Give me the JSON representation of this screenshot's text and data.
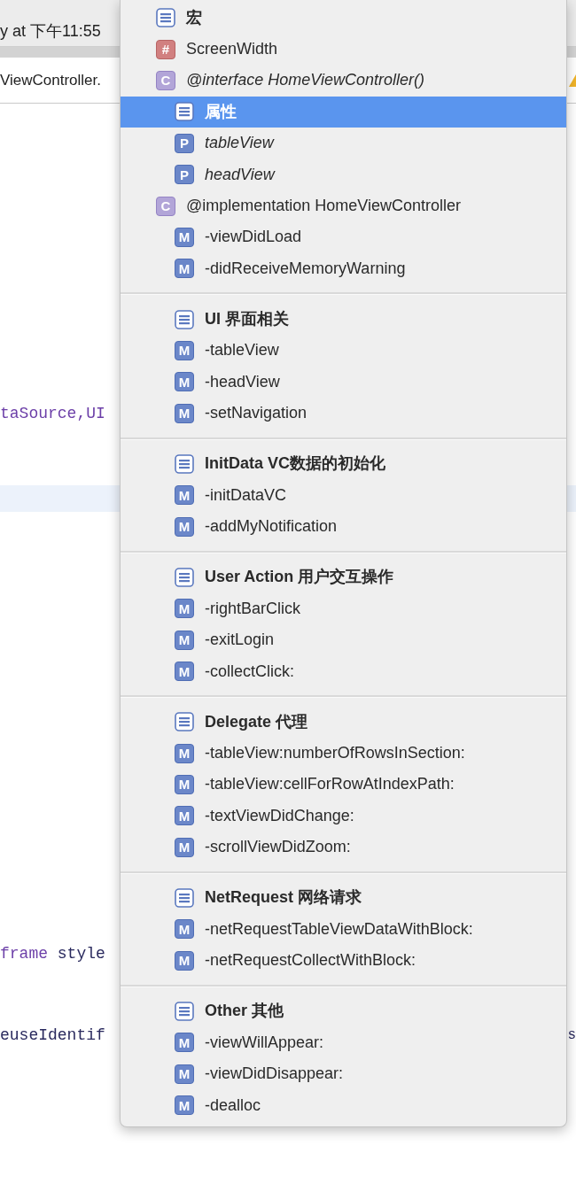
{
  "toolbar": {
    "status": "y at 下午11:55"
  },
  "jump_bar": {
    "path": "ViewController.",
    "warning": true
  },
  "code": {
    "lines": [
      {
        "tokens": [
          {
            "text": "taSource,UI",
            "kind": "type"
          }
        ]
      },
      {
        "current": true
      },
      {
        "tokens": [
          {
            "text": "frame",
            "kind": "type"
          },
          {
            "text": " style",
            "kind": "plain"
          }
        ]
      },
      {
        "tokens": [
          {
            "text": "euseIdentif",
            "kind": "plain"
          }
        ],
        "tail": "s"
      }
    ]
  },
  "menu": {
    "items": [
      {
        "kind": "pragma",
        "label": "宏",
        "selected": false
      },
      {
        "kind": "macro",
        "badge": "#",
        "label": "ScreenWidth",
        "selected": false
      },
      {
        "kind": "class_extension",
        "badge": "C",
        "label": "@interface HomeViewController()",
        "selected": false,
        "children": [
          {
            "kind": "pragma",
            "label": "属性",
            "selected": true
          },
          {
            "kind": "property",
            "badge": "P",
            "label": "tableView",
            "selected": false
          },
          {
            "kind": "property",
            "badge": "P",
            "label": "headView",
            "selected": false
          }
        ]
      },
      {
        "kind": "class",
        "badge": "C",
        "label": "@implementation HomeViewController",
        "selected": false,
        "children": [
          {
            "kind": "method",
            "badge": "M",
            "label": "-viewDidLoad",
            "selected": false
          },
          {
            "kind": "method",
            "badge": "M",
            "label": "-didReceiveMemoryWarning",
            "selected": false
          },
          {
            "kind": "divider"
          },
          {
            "kind": "pragma",
            "label": "UI 界面相关",
            "selected": false
          },
          {
            "kind": "method",
            "badge": "M",
            "label": "-tableView",
            "selected": false
          },
          {
            "kind": "method",
            "badge": "M",
            "label": "-headView",
            "selected": false
          },
          {
            "kind": "method",
            "badge": "M",
            "label": "-setNavigation",
            "selected": false
          },
          {
            "kind": "divider"
          },
          {
            "kind": "pragma",
            "label": "InitData VC数据的初始化",
            "selected": false
          },
          {
            "kind": "method",
            "badge": "M",
            "label": "-initDataVC",
            "selected": false
          },
          {
            "kind": "method",
            "badge": "M",
            "label": "-addMyNotification",
            "selected": false
          },
          {
            "kind": "divider"
          },
          {
            "kind": "pragma",
            "label": "User Action 用户交互操作",
            "selected": false
          },
          {
            "kind": "method",
            "badge": "M",
            "label": "-rightBarClick",
            "selected": false
          },
          {
            "kind": "method",
            "badge": "M",
            "label": "-exitLogin",
            "selected": false
          },
          {
            "kind": "method",
            "badge": "M",
            "label": "-collectClick:",
            "selected": false
          },
          {
            "kind": "divider"
          },
          {
            "kind": "pragma",
            "label": "Delegate 代理",
            "selected": false
          },
          {
            "kind": "method",
            "badge": "M",
            "label": "-tableView:numberOfRowsInSection:",
            "selected": false
          },
          {
            "kind": "method",
            "badge": "M",
            "label": "-tableView:cellForRowAtIndexPath:",
            "selected": false
          },
          {
            "kind": "method",
            "badge": "M",
            "label": "-textViewDidChange:",
            "selected": false
          },
          {
            "kind": "method",
            "badge": "M",
            "label": "-scrollViewDidZoom:",
            "selected": false
          },
          {
            "kind": "divider"
          },
          {
            "kind": "pragma",
            "label": "NetRequest 网络请求",
            "selected": false
          },
          {
            "kind": "method",
            "badge": "M",
            "label": "-netRequestTableViewDataWithBlock:",
            "selected": false
          },
          {
            "kind": "method",
            "badge": "M",
            "label": "-netRequestCollectWithBlock:",
            "selected": false
          },
          {
            "kind": "divider"
          },
          {
            "kind": "pragma",
            "label": "Other 其他",
            "selected": false
          },
          {
            "kind": "method",
            "badge": "M",
            "label": "-viewWillAppear:",
            "selected": false
          },
          {
            "kind": "method",
            "badge": "M",
            "label": "-viewDidDisappear:",
            "selected": false
          },
          {
            "kind": "method",
            "badge": "M",
            "label": "-dealloc",
            "selected": false
          }
        ]
      }
    ]
  }
}
